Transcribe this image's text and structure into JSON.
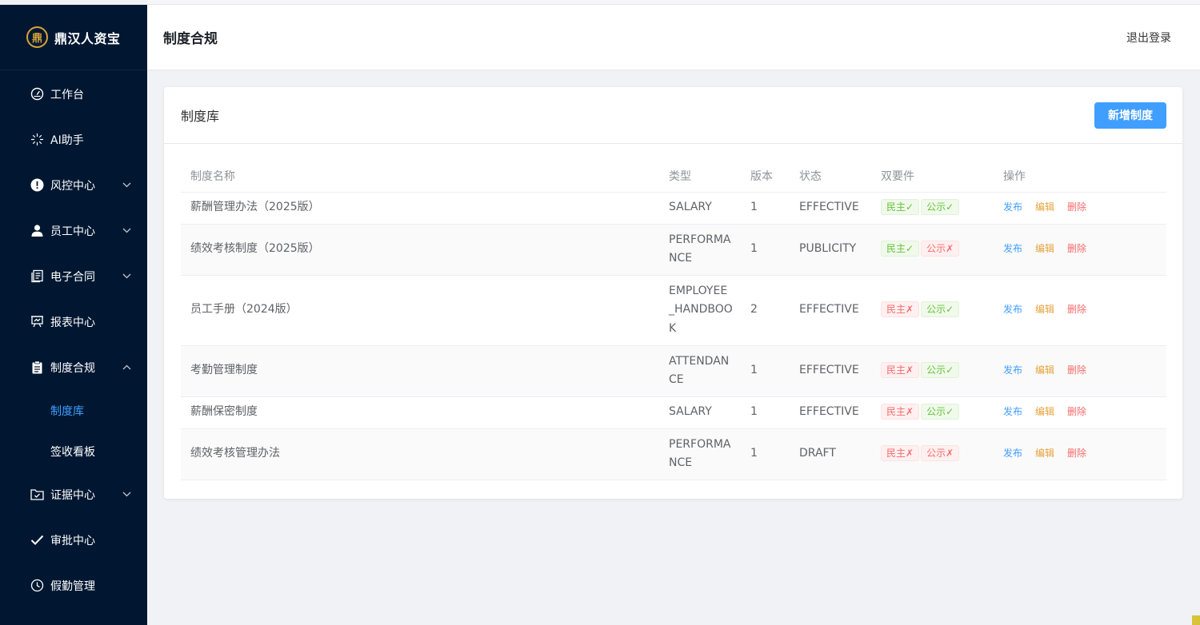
{
  "brand": {
    "logo_char": "鼎",
    "name": "鼎汉人资宝"
  },
  "sidebar": {
    "items": [
      {
        "label": "工作台",
        "icon": "dashboard-icon",
        "has_children": false
      },
      {
        "label": "AI助手",
        "icon": "sparkle-icon",
        "has_children": false
      },
      {
        "label": "风控中心",
        "icon": "warning-icon",
        "has_children": true,
        "expanded": false
      },
      {
        "label": "员工中心",
        "icon": "user-icon",
        "has_children": true,
        "expanded": false
      },
      {
        "label": "电子合同",
        "icon": "document-icon",
        "has_children": true,
        "expanded": false
      },
      {
        "label": "报表中心",
        "icon": "presentation-icon",
        "has_children": false
      },
      {
        "label": "制度合规",
        "icon": "clipboard-icon",
        "has_children": true,
        "expanded": true
      },
      {
        "label": "证据中心",
        "icon": "folder-check-icon",
        "has_children": true,
        "expanded": false
      },
      {
        "label": "审批中心",
        "icon": "check-icon",
        "has_children": false
      },
      {
        "label": "假勤管理",
        "icon": "clock-icon",
        "has_children": false
      }
    ],
    "submenu": [
      {
        "label": "制度库",
        "active": true
      },
      {
        "label": "签收看板",
        "active": false
      }
    ]
  },
  "header": {
    "title": "制度合规",
    "logout": "退出登录"
  },
  "card": {
    "title": "制度库",
    "add_button": "新增制度"
  },
  "table": {
    "columns": [
      "制度名称",
      "类型",
      "版本",
      "状态",
      "双要件",
      "操作"
    ],
    "rows": [
      {
        "name": "薪酬管理办法（2025版）",
        "type": "SALARY",
        "version": "1",
        "status": "EFFECTIVE",
        "democracy": "民主✓",
        "democracy_ok": true,
        "publicity": "公示✓",
        "publicity_ok": true
      },
      {
        "name": "绩效考核制度（2025版）",
        "type": "PERFORMANCE",
        "version": "1",
        "status": "PUBLICITY",
        "democracy": "民主✓",
        "democracy_ok": true,
        "publicity": "公示✗",
        "publicity_ok": false
      },
      {
        "name": "员工手册（2024版）",
        "type": "EMPLOYEE_HANDBOOK",
        "version": "2",
        "status": "EFFECTIVE",
        "democracy": "民主✗",
        "democracy_ok": false,
        "publicity": "公示✓",
        "publicity_ok": true
      },
      {
        "name": "考勤管理制度",
        "type": "ATTENDANCE",
        "version": "1",
        "status": "EFFECTIVE",
        "democracy": "民主✗",
        "democracy_ok": false,
        "publicity": "公示✓",
        "publicity_ok": true
      },
      {
        "name": "薪酬保密制度",
        "type": "SALARY",
        "version": "1",
        "status": "EFFECTIVE",
        "democracy": "民主✗",
        "democracy_ok": false,
        "publicity": "公示✓",
        "publicity_ok": true
      },
      {
        "name": "绩效考核管理办法",
        "type": "PERFORMANCE",
        "version": "1",
        "status": "DRAFT",
        "democracy": "民主✗",
        "democracy_ok": false,
        "publicity": "公示✗",
        "publicity_ok": false
      }
    ],
    "actions": {
      "publish": "发布",
      "edit": "编辑",
      "delete": "删除"
    }
  },
  "colors": {
    "sidebar_bg": "#011731",
    "accent": "#409eff",
    "ok": "#67c23a",
    "warn": "#e6a23c",
    "danger": "#f56c6c"
  }
}
